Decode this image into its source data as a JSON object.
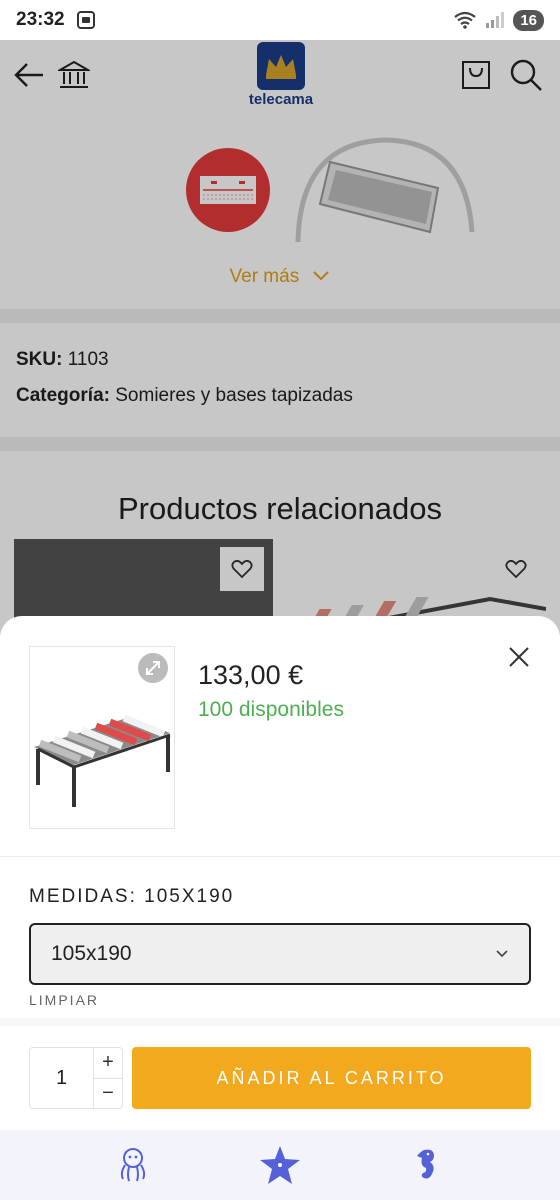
{
  "status_bar": {
    "time": "23:32",
    "battery": "16"
  },
  "header": {
    "logo_text": "telecama"
  },
  "categories": {
    "see_more": "Ver más"
  },
  "meta": {
    "sku_label": "SKU:",
    "sku_value": "1103",
    "category_label": "Categoría:",
    "category_value": "Somieres y bases tapizadas"
  },
  "related": {
    "title": "Productos relacionados"
  },
  "sheet": {
    "price": "133,00 €",
    "stock": "100 disponibles",
    "size_label": "MEDIDAS:",
    "size_value": "105X190",
    "select_value": "105x190",
    "clear_label": "LIMPIAR",
    "quantity": "1",
    "plus": "+",
    "minus": "−",
    "add_to_cart": "AÑADIR AL CARRITO"
  },
  "colors": {
    "accent": "#f2a91e",
    "stock": "#4caf50",
    "link": "#e2a116",
    "nav_icons": "#5561d8"
  },
  "bottom_nav": [
    "octopus-icon",
    "starfish-icon",
    "seahorse-icon"
  ]
}
